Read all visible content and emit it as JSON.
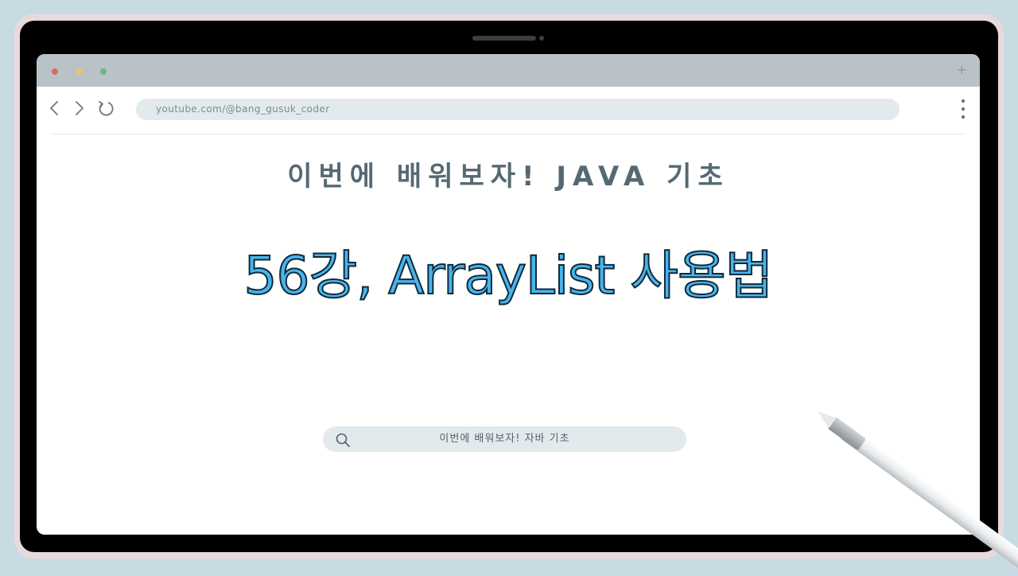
{
  "browser": {
    "url": "youtube.com/@bang_gusuk_coder",
    "new_tab_symbol": "+"
  },
  "page": {
    "subtitle": "이번에 배워보자! JAVA 기초",
    "title": "56강, ArrayList 사용법"
  },
  "search": {
    "text": "이번에 배워보자! 자바 기초"
  },
  "icons": {
    "back": "chevron-left-icon",
    "forward": "chevron-right-icon",
    "reload": "reload-icon",
    "menu": "kebab-menu-icon",
    "search": "search-icon"
  },
  "colors": {
    "background": "#c8dbe3",
    "title_fill": "#4ab4ec",
    "subtitle": "#566973",
    "address_bar": "#e3eaed",
    "title_bar": "#b9c3c7"
  }
}
